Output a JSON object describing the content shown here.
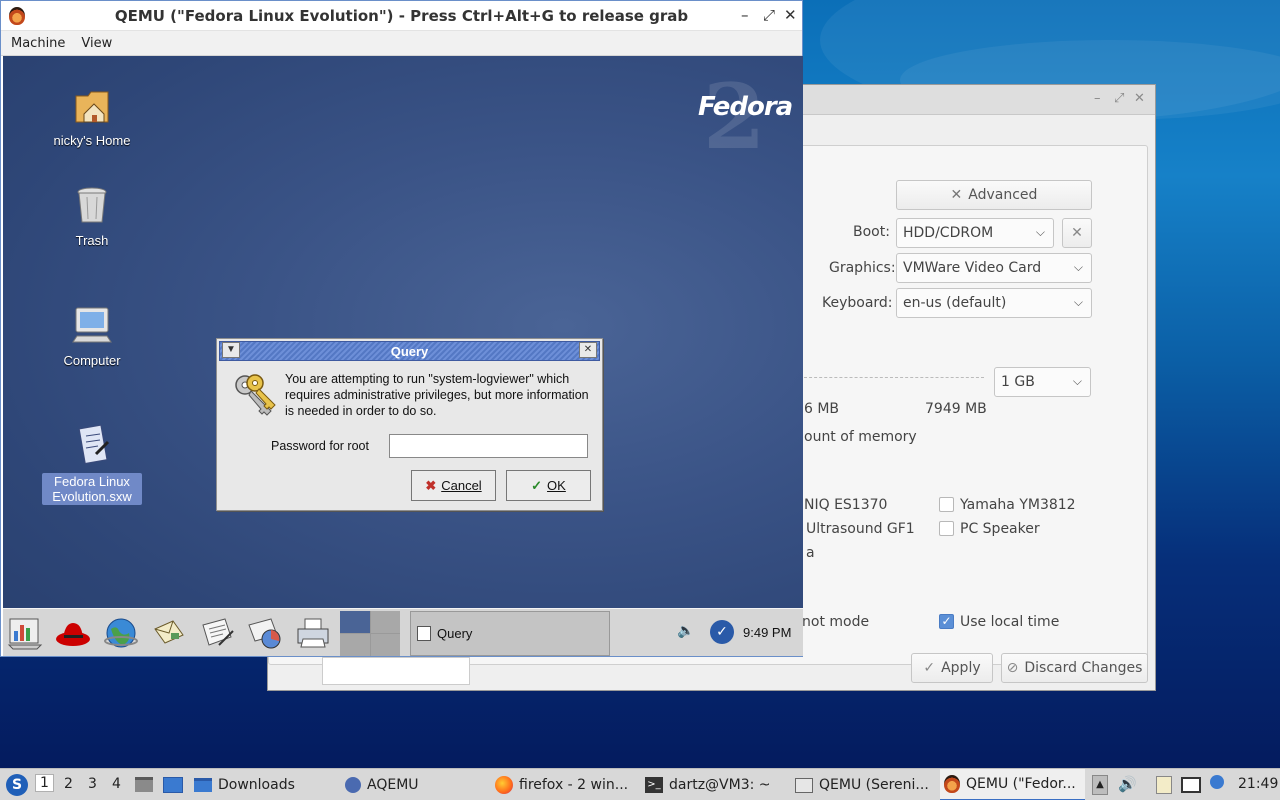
{
  "qemu_window": {
    "title": "QEMU (\"Fedora Linux Evolution\") - Press Ctrl+Alt+G to release grab",
    "controls": {
      "minimize": "–",
      "maximize": "⤢",
      "close": "✕"
    },
    "menu": [
      "Machine",
      "View"
    ]
  },
  "guest": {
    "logo": "Fedora",
    "logo_version": "2",
    "desktop_icons": [
      {
        "label": "nicky's Home",
        "icon": "home-folder-icon"
      },
      {
        "label": "Trash",
        "icon": "trash-icon"
      },
      {
        "label": "Computer",
        "icon": "computer-icon"
      },
      {
        "label": "Fedora Linux Evolution.sxw",
        "icon": "document-icon"
      }
    ],
    "query_dialog": {
      "title": "Query",
      "message": "You are attempting to run \"system-logviewer\" which requires administrative privileges, but more information is needed in order to do so.",
      "password_label": "Password for root",
      "password_value": "",
      "cancel_label": "Cancel",
      "ok_label": "OK"
    },
    "panel": {
      "task_label": "Query",
      "clock": "9:49 PM"
    }
  },
  "aqemu_window": {
    "advanced_label": "Advanced",
    "boot_label": "Boot:",
    "boot_value": "HDD/CDROM",
    "graphics_label": "Graphics:",
    "graphics_value": "VMWare Video Card",
    "keyboard_label": "Keyboard:",
    "keyboard_value": "en-us (default)",
    "memory_value": "1 GB",
    "mem_min_partial": "6 MB",
    "mem_max": "7949 MB",
    "mem_note_partial": "ount of memory",
    "sound_left_1": "NIQ ES1370",
    "sound_left_2": "Ultrasound GF1",
    "sound_left_3": "a",
    "sound_right_1": "Yamaha YM3812",
    "sound_right_2": "PC Speaker",
    "snapshot_partial": "not mode",
    "local_time_label": "Use local time",
    "local_time_checked": true,
    "apply_label": "Apply",
    "discard_label": "Discard Changes"
  },
  "taskbar": {
    "workspaces": [
      "1",
      "2",
      "3",
      "4"
    ],
    "tasks": [
      {
        "label": "Downloads"
      },
      {
        "label": "AQEMU"
      },
      {
        "label": "firefox - 2 win..."
      },
      {
        "label": "dartz@VM3: ~"
      },
      {
        "label": "QEMU (Sereni..."
      },
      {
        "label": "QEMU (\"Fedor..."
      }
    ],
    "clock": "21:49"
  }
}
